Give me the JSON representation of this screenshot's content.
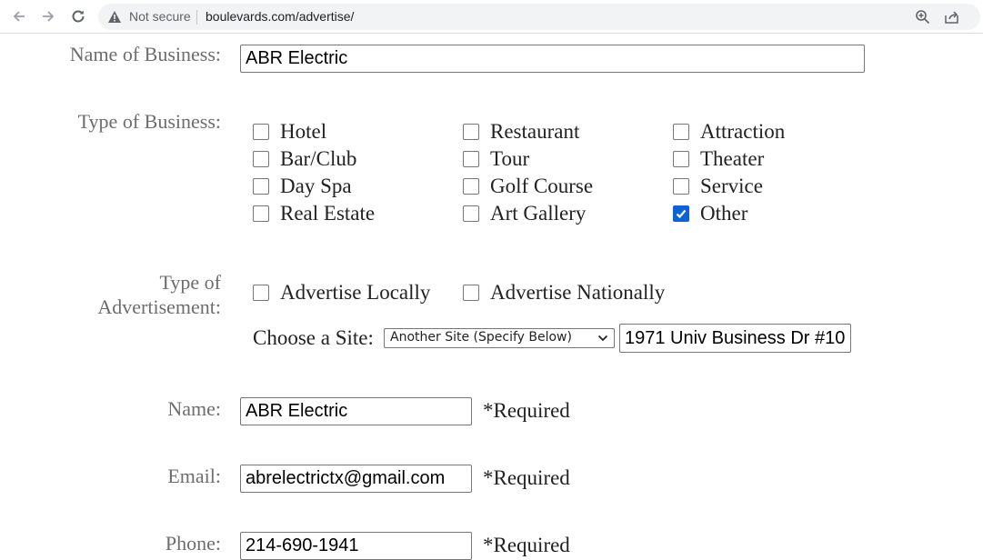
{
  "browser": {
    "security_label": "Not secure",
    "url": "boulevards.com/advertise/"
  },
  "form": {
    "business_name": {
      "label": "Name of Business:",
      "value": "ABR Electric"
    },
    "business_type": {
      "label": "Type of Business:",
      "options": [
        {
          "label": "Hotel",
          "checked": false
        },
        {
          "label": "Restaurant",
          "checked": false
        },
        {
          "label": "Attraction",
          "checked": false
        },
        {
          "label": "Bar/Club",
          "checked": false
        },
        {
          "label": "Tour",
          "checked": false
        },
        {
          "label": "Theater",
          "checked": false
        },
        {
          "label": "Day Spa",
          "checked": false
        },
        {
          "label": "Golf Course",
          "checked": false
        },
        {
          "label": "Service",
          "checked": false
        },
        {
          "label": "Real Estate",
          "checked": false
        },
        {
          "label": "Art Gallery",
          "checked": false
        },
        {
          "label": "Other",
          "checked": true
        }
      ]
    },
    "advertisement_type": {
      "label_line1": "Type of",
      "label_line2": "Advertisement:",
      "options": [
        {
          "label": "Advertise Locally",
          "checked": false
        },
        {
          "label": "Advertise Nationally",
          "checked": false
        }
      ],
      "site_label": "Choose a Site:",
      "site_selected": "Another Site (Specify Below)",
      "site_other_value": "1971 Univ Business Dr #10"
    },
    "name": {
      "label": "Name:",
      "value": "ABR Electric",
      "required": "*Required"
    },
    "email": {
      "label": "Email:",
      "value": "abrelectrictx@gmail.com",
      "required": "*Required"
    },
    "phone": {
      "label": "Phone:",
      "value": "214-690-1941",
      "required": "*Required"
    }
  },
  "colors": {
    "checkbox_checked": "#0b63d5",
    "label_gray": "#6d6d6d"
  }
}
